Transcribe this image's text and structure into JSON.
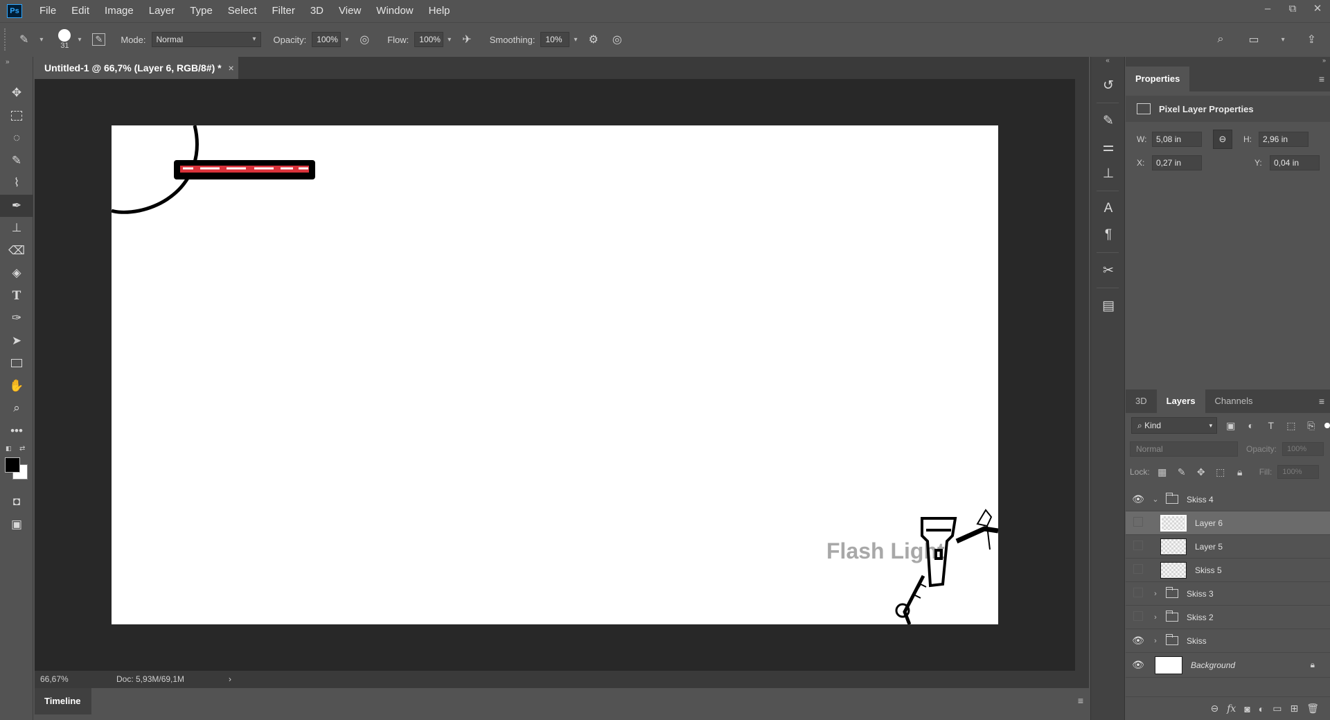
{
  "menu": {
    "items": [
      "File",
      "Edit",
      "Image",
      "Layer",
      "Type",
      "Select",
      "Filter",
      "3D",
      "View",
      "Window",
      "Help"
    ],
    "logo": "Ps",
    "window_controls": [
      "–",
      "⧉",
      "✕"
    ]
  },
  "options": {
    "brush_size": "31",
    "mode_label": "Mode:",
    "mode_value": "Normal",
    "opacity_label": "Opacity:",
    "opacity_value": "100%",
    "flow_label": "Flow:",
    "flow_value": "100%",
    "smoothing_label": "Smoothing:",
    "smoothing_value": "10%"
  },
  "document": {
    "tab_title": "Untitled-1 @ 66,7% (Layer 6, RGB/8#) *",
    "tab_close": "×",
    "canvas_text": "Flash Light",
    "zoom": "66,67%",
    "doc_info": "Doc: 5,93M/69,1M",
    "status_arrow": "›"
  },
  "timeline": {
    "label": "Timeline"
  },
  "properties": {
    "tab": "Properties",
    "header": "Pixel Layer Properties",
    "w_label": "W:",
    "w_value": "5,08 in",
    "h_label": "H:",
    "h_value": "2,96 in",
    "x_label": "X:",
    "x_value": "0,27 in",
    "y_label": "Y:",
    "y_value": "0,04 in"
  },
  "layers_panel": {
    "tabs": [
      "3D",
      "Layers",
      "Channels"
    ],
    "kind_label": "Kind",
    "blend_mode": "Normal",
    "opacity_label": "Opacity:",
    "opacity_value": "100%",
    "lock_label": "Lock:",
    "fill_label": "Fill:",
    "fill_value": "100%",
    "layers": [
      {
        "name": "Skiss 4",
        "type": "group",
        "visible": true,
        "expanded": true
      },
      {
        "name": "Layer 6",
        "type": "pixel",
        "visible": false,
        "selected": true
      },
      {
        "name": "Layer 5",
        "type": "pixel",
        "visible": false
      },
      {
        "name": "Skiss 5",
        "type": "pixel",
        "visible": false
      },
      {
        "name": "Skiss 3",
        "type": "group",
        "visible": false
      },
      {
        "name": "Skiss 2",
        "type": "group",
        "visible": false
      },
      {
        "name": "Skiss",
        "type": "group",
        "visible": true
      },
      {
        "name": "Background",
        "type": "background",
        "visible": true,
        "locked": true
      }
    ]
  },
  "colors": {
    "ui_bg": "#535353",
    "pasteboard": "#282828",
    "stripe_red": "#d9323a",
    "canvas_text": "#a8a8a8"
  }
}
